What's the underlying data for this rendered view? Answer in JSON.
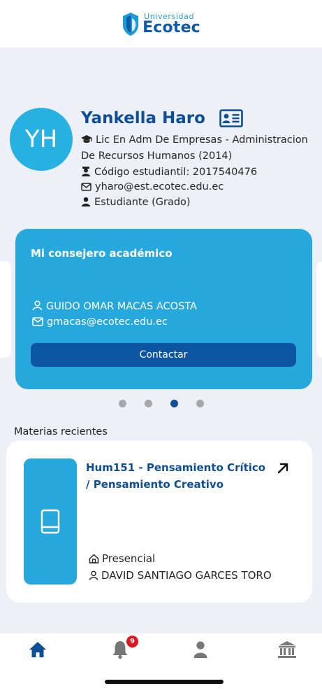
{
  "header": {
    "logo_small": "Universidad",
    "logo_big": "Ecotec"
  },
  "profile": {
    "initials": "YH",
    "name": "Yankella Haro",
    "career_line1": "Lic En Adm De Empresas  - Administracion",
    "career_line2": "De Recursos Humanos (2014)",
    "student_code": "Código estudiantil: 2017540476",
    "email": "yharo@est.ecotec.edu.ec",
    "role": "Estudiante (Grado)"
  },
  "advisor": {
    "title": "Mi consejero académico",
    "name": "GUIDO OMAR MACAS ACOSTA",
    "email": "gmacas@ecotec.edu.ec",
    "button": "Contactar"
  },
  "carousel": {
    "count": 4,
    "active_index": 2
  },
  "recent": {
    "section_title": "Materias recientes",
    "course": {
      "title": "Hum151 - Pensamiento Crítico / Pensamiento Creativo",
      "mode": "Presencial",
      "teacher": "DAVID SANTIAGO GARCES TORO"
    }
  },
  "nav": {
    "items": [
      "home-icon",
      "bell-icon",
      "user-icon",
      "institution-icon"
    ],
    "notifications_badge": "9",
    "active": "home-icon"
  },
  "colors": {
    "primary_dark": "#0e4e94",
    "accent_blue": "#27a8dd",
    "button_blue": "#0c55a2",
    "background": "#eef0f8",
    "badge_red": "#e0141e"
  }
}
